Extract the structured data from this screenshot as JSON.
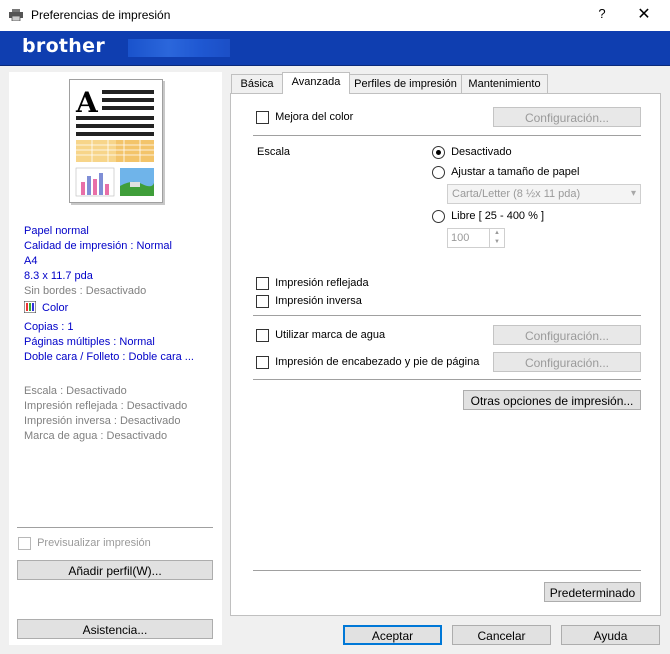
{
  "window": {
    "title": "Preferencias de impresión",
    "help_glyph": "?",
    "close_glyph": "✕",
    "brand": "brother"
  },
  "left": {
    "media": "Papel normal",
    "quality": "Calidad de impresión : Normal",
    "size": "A4",
    "dimensions": "8.3 x 11.7 pda",
    "borderless": "Sin bordes : Desactivado",
    "color": "Color",
    "copies": "Copias : 1",
    "multipage": "Páginas múltiples : Normal",
    "duplex": "Doble cara / Folleto : Doble cara ...",
    "scale": "Escala : Desactivado",
    "mirror": "Impresión reflejada : Desactivado",
    "reverse": "Impresión inversa : Desactivado",
    "watermark": "Marca de agua : Desactivado",
    "preview_label": "Previsualizar impresión",
    "add_profile": "Añadir perfil(W)...",
    "support": "Asistencia..."
  },
  "tabs": [
    "Básica",
    "Avanzada",
    "Perfiles de impresión",
    "Mantenimiento"
  ],
  "advanced": {
    "color_enhancement": "Mejora del color",
    "settings": "Configuración...",
    "scale_label": "Escala",
    "scale_off": "Desactivado",
    "scale_fit": "Ajustar a tamaño de papel",
    "paper_select": "Carta/Letter (8 ½x 11 pda)",
    "scale_free": "Libre [ 25 - 400 % ]",
    "scale_value": "100",
    "mirror": "Impresión reflejada",
    "reverse": "Impresión inversa",
    "watermark": "Utilizar marca de agua",
    "header_footer": "Impresión de encabezado y pie de página",
    "other_options": "Otras opciones de impresión...",
    "default": "Predeterminado"
  },
  "footer": {
    "ok": "Aceptar",
    "cancel": "Cancelar",
    "help": "Ayuda"
  },
  "colors": {
    "brand_bar": "#0f3eb0",
    "link_blue": "#0000c8"
  }
}
